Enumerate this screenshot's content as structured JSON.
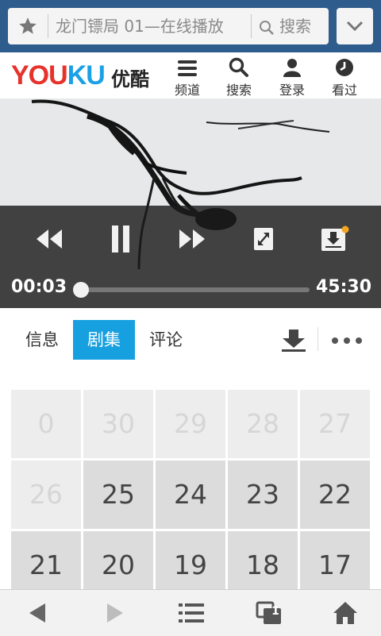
{
  "browser": {
    "url_title": "龙门镖局 01—在线播放",
    "search_label": "搜索"
  },
  "youku": {
    "logo_text_1": "YOU",
    "logo_text_2": "KU",
    "logo_cn": "优酷",
    "nav": [
      {
        "label": "频道",
        "icon": "menu-icon"
      },
      {
        "label": "搜索",
        "icon": "search-icon"
      },
      {
        "label": "登录",
        "icon": "user-icon"
      },
      {
        "label": "看过",
        "icon": "clock-icon"
      }
    ]
  },
  "player": {
    "current_time": "00:03",
    "total_time": "45:30",
    "progress": 0.001
  },
  "tabs": [
    {
      "label": "信息"
    },
    {
      "label": "剧集"
    },
    {
      "label": "评论"
    }
  ],
  "episodes": [
    {
      "num": "0",
      "available": false
    },
    {
      "num": "30",
      "available": false
    },
    {
      "num": "29",
      "available": false
    },
    {
      "num": "28",
      "available": false
    },
    {
      "num": "27",
      "available": false
    },
    {
      "num": "26",
      "available": false
    },
    {
      "num": "25",
      "available": true
    },
    {
      "num": "24",
      "available": true
    },
    {
      "num": "23",
      "available": true
    },
    {
      "num": "22",
      "available": true
    },
    {
      "num": "21",
      "available": true
    },
    {
      "num": "20",
      "available": true
    },
    {
      "num": "19",
      "available": true
    },
    {
      "num": "18",
      "available": true
    },
    {
      "num": "17",
      "available": true
    }
  ],
  "toolbar": {
    "window_count": "1"
  },
  "colors": {
    "browser_bar": "#2e5c8c",
    "active_tab": "#17a0e0",
    "logo_red": "#e8312a",
    "logo_blue": "#1aa0e6"
  }
}
